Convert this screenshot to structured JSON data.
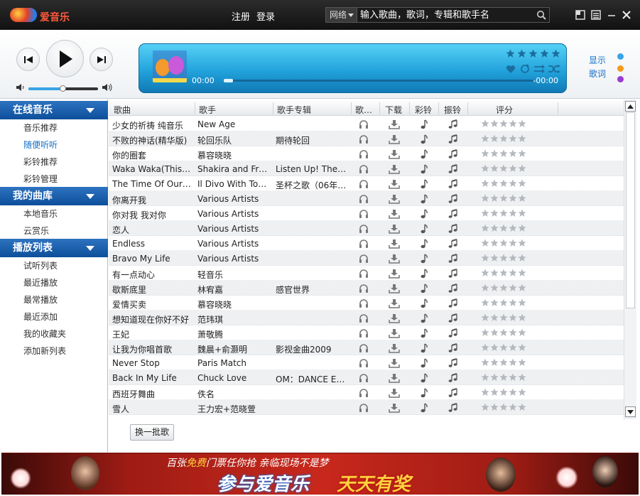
{
  "app": {
    "name": "爱音乐"
  },
  "topnav": {
    "register": "注册",
    "login": "登录"
  },
  "search": {
    "scope": "网络",
    "placeholder": "输入歌曲，歌词，专辑和歌手名"
  },
  "player": {
    "time_current": "00:00",
    "time_remaining": "-00:00",
    "progress_fraction": 0.03,
    "volume_fraction": 0.5
  },
  "side_links": {
    "show": "显示",
    "lyrics": "歌词",
    "dot_colors": [
      "#39a3e6",
      "#f39a1e",
      "#9a3bd1"
    ]
  },
  "sidebar": {
    "sections": [
      {
        "title": "在线音乐",
        "items": [
          "音乐推荐",
          "随便听听",
          "彩铃推荐",
          "彩铃管理"
        ]
      },
      {
        "title": "我的曲库",
        "items": [
          "本地音乐",
          "云赏乐"
        ]
      },
      {
        "title": "播放列表",
        "items": [
          "试听列表",
          "最近播放",
          "最常播放",
          "最近添加",
          "我的收藏夹",
          "添加新列表"
        ]
      }
    ],
    "active_item": "随便听听"
  },
  "table": {
    "headers": [
      "歌曲",
      "歌手",
      "歌手专辑",
      "歌…",
      "下载",
      "彩铃",
      "振铃",
      "评分"
    ],
    "rows": [
      [
        "少女的祈祷 纯音乐",
        "New Age",
        ""
      ],
      [
        "不败的神话(精华版)",
        "轮回乐队",
        "期待轮回"
      ],
      [
        "你的圈套",
        "慕容晓晓",
        ""
      ],
      [
        "Waka Waka(This Ti…",
        "Shakira and Fresh…",
        "Listen Up! The Of…"
      ],
      [
        "The Time Of Our Lives",
        "Il Divo With Toni …",
        "圣杯之歌（06年…"
      ],
      [
        "你离开我",
        "Various Artists",
        ""
      ],
      [
        "你对我 我对你",
        "Various Artists",
        ""
      ],
      [
        "恋人",
        "Various Artists",
        ""
      ],
      [
        "Endless",
        "Various Artists",
        ""
      ],
      [
        "Bravo My Life",
        "Various Artists",
        ""
      ],
      [
        "有一点动心",
        "轻音乐",
        ""
      ],
      [
        "歇斯底里",
        "林宥嘉",
        "感官世界"
      ],
      [
        "爱情买卖",
        "慕容晓晓",
        ""
      ],
      [
        "想知道现在你好不好",
        "范玮琪",
        ""
      ],
      [
        "王妃",
        "萧敬腾",
        ""
      ],
      [
        "让我为你唱首歌",
        "魏晨+俞灏明",
        "影视金曲2009"
      ],
      [
        "Never Stop",
        "Paris Match",
        ""
      ],
      [
        "Back In My Life",
        "Chuck Love",
        "OM：DANCE ESS…"
      ],
      [
        "西班牙舞曲",
        "佚名",
        ""
      ],
      [
        "雪人",
        "王力宏+范晓萱",
        ""
      ]
    ],
    "rating_stars": 5
  },
  "more_button": "换一批歌",
  "banner": {
    "line1_a": "百张",
    "line1_hl": "免费",
    "line1_b": "门票任你抢 亲临现场不是梦",
    "line2": "参与爱音乐",
    "line3": "天天有奖"
  }
}
